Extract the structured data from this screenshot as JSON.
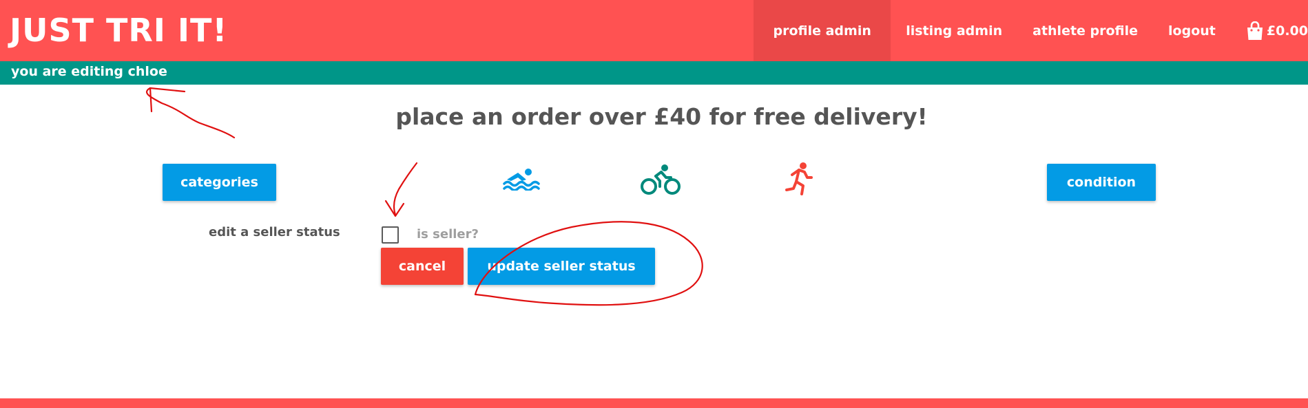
{
  "navbar": {
    "brand": "JUST TRI IT!",
    "items": [
      {
        "label": "Profile Admin",
        "active": true
      },
      {
        "label": "Listing Admin",
        "active": false
      },
      {
        "label": "Athlete Profile",
        "active": false
      },
      {
        "label": "Logout",
        "active": false
      }
    ],
    "cart_total": "£0.00",
    "cart_icon": "shopping-bag-icon"
  },
  "edit_banner": "You are editing chloe",
  "promo": "Place an order over £40 for free delivery!",
  "filters": {
    "categories_label": "Categories",
    "condition_label": "Condition",
    "sports": [
      {
        "icon": "swimming-icon",
        "color": "#039be5"
      },
      {
        "icon": "cycling-icon",
        "color": "#00897b"
      },
      {
        "icon": "running-icon",
        "color": "#f44336"
      }
    ]
  },
  "seller_form": {
    "heading": "Edit a Seller Status",
    "checkbox_label": "Is Seller?",
    "checked": false,
    "cancel_label": "Cancel",
    "submit_label": "Update Seller Status"
  },
  "colors": {
    "primary": "#ff5252",
    "teal": "#009688",
    "blue": "#039be5",
    "red": "#f44336",
    "annotation": "#e01010"
  }
}
